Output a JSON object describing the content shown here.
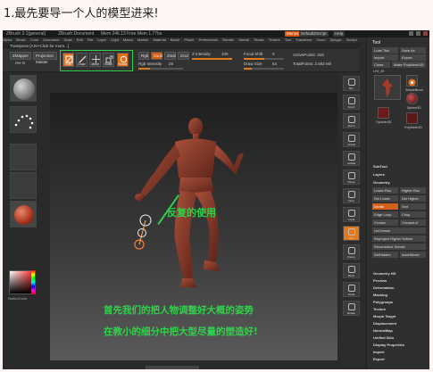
{
  "caption": "1.最先要导一个人的模型进来!",
  "window": {
    "app_title": "ZBrush 3.1[general]",
    "doc": "ZBrush Document",
    "mem": "Mem 246.13  Free Mem 1.77bs",
    "menus_btn": "Menus",
    "script_btn": "DefaultZScript",
    "help_btn": "Help"
  },
  "menubar": [
    "Alpha",
    "Brush",
    "Color",
    "Document",
    "Draw",
    "Edit",
    "File",
    "Layer",
    "Light",
    "Macro",
    "Marker",
    "Material",
    "Movie",
    "Picker",
    "Preferences",
    "Render",
    "Stencil",
    "Stroke",
    "Texture",
    "Tool",
    "Transform",
    "Zoom",
    "Zplugin",
    "Zscript"
  ],
  "hint": "Transpose [ASt+Click for more...]",
  "toolbar": {
    "zmapper_label": "ZMapper",
    "zmapper_sub": "rev-G",
    "projection_label": "Projection Master",
    "modes": [
      "Edit",
      "Draw",
      "Move",
      "Scale",
      "Rotate"
    ],
    "rgb_label": "Rgb",
    "zadd_label": "Zadd",
    "zsub_label": "Zsub",
    "zcut_label": "Zcut",
    "focal_label": "Focal Shift",
    "focal_value": "0",
    "draw_size_label": "Draw Size",
    "draw_size_value": "64",
    "z_intensity_label": "Z Intensity",
    "z_intensity_value": "100",
    "rgb_intensity_label": "Rgb Intensity",
    "rgb_intensity_value": "25",
    "active_points": "ActivePoints: 318",
    "total_points": "TotalPoints: 2.582 Mil",
    "focal_fill": 0.5,
    "draw_size_fill": 0.2,
    "z_fill": 1.0,
    "rgb_fill": 0.25
  },
  "left_shelf": {
    "switch_color": "SwitchColor"
  },
  "right_shelf": [
    "Bpr",
    "Scroll",
    "Zoom",
    "Actual",
    "AAHalf",
    "Persp",
    "Floor",
    "Local",
    "Xyz",
    "Frame",
    "Move",
    "Scale",
    "Rotate"
  ],
  "tool_panel": {
    "title": "Tool",
    "load_tool": "Load Tool",
    "save_as": "Save As",
    "import": "Import",
    "export": "Export",
    "clone": "Clone",
    "make_polymesh": "Make PolyMesh3D",
    "polymesh_label": "LH1_49",
    "thumbs": [
      "LH1_49",
      "SimpleBrush",
      "Sphere3D",
      "Cylinder3D",
      "PolyMesh3D"
    ],
    "sections": [
      "SubTool",
      "Layers",
      "Geometry"
    ],
    "geometry_rows": [
      {
        "left": "Lower Res",
        "right": "Higher Res"
      },
      {
        "left": "Del Lower",
        "right": "Del Higher"
      },
      {
        "left": "Divide",
        "right": "Smt"
      },
      {
        "left": "Edge Loop",
        "right": "Crisp"
      },
      {
        "left": "Crease",
        "right": "CreaseLvl"
      },
      {
        "left": "UnCrease",
        "right": ""
      },
      {
        "left": "Reproject Higher Subdiv",
        "right": ""
      },
      {
        "left": "Reconstruct Subdiv",
        "right": ""
      },
      {
        "left": "DelHidden",
        "right": "InsertMesh"
      }
    ],
    "sdiv_label": "SDiv",
    "sdiv_value": "5",
    "cage_label": "Cage",
    "crease_value": "15",
    "menu_items": [
      "Geometry HD",
      "Preview",
      "Deformation",
      "Masking",
      "Polygroups",
      "Texture",
      "Morph Target",
      "Displacement",
      "NormalMap",
      "Unified Skin",
      "Display Properties",
      "Import",
      "Export"
    ]
  },
  "annotations": {
    "label1": "反复的使用",
    "label2": "首先我们的把人物调整好大概的姿势",
    "label3": "在教小的细分中把大型尽量的塑造好!"
  },
  "colors": {
    "accent_orange": "#e07a1c",
    "annotation_green": "#2fd34a",
    "figure_red": "#8c3a2c"
  }
}
